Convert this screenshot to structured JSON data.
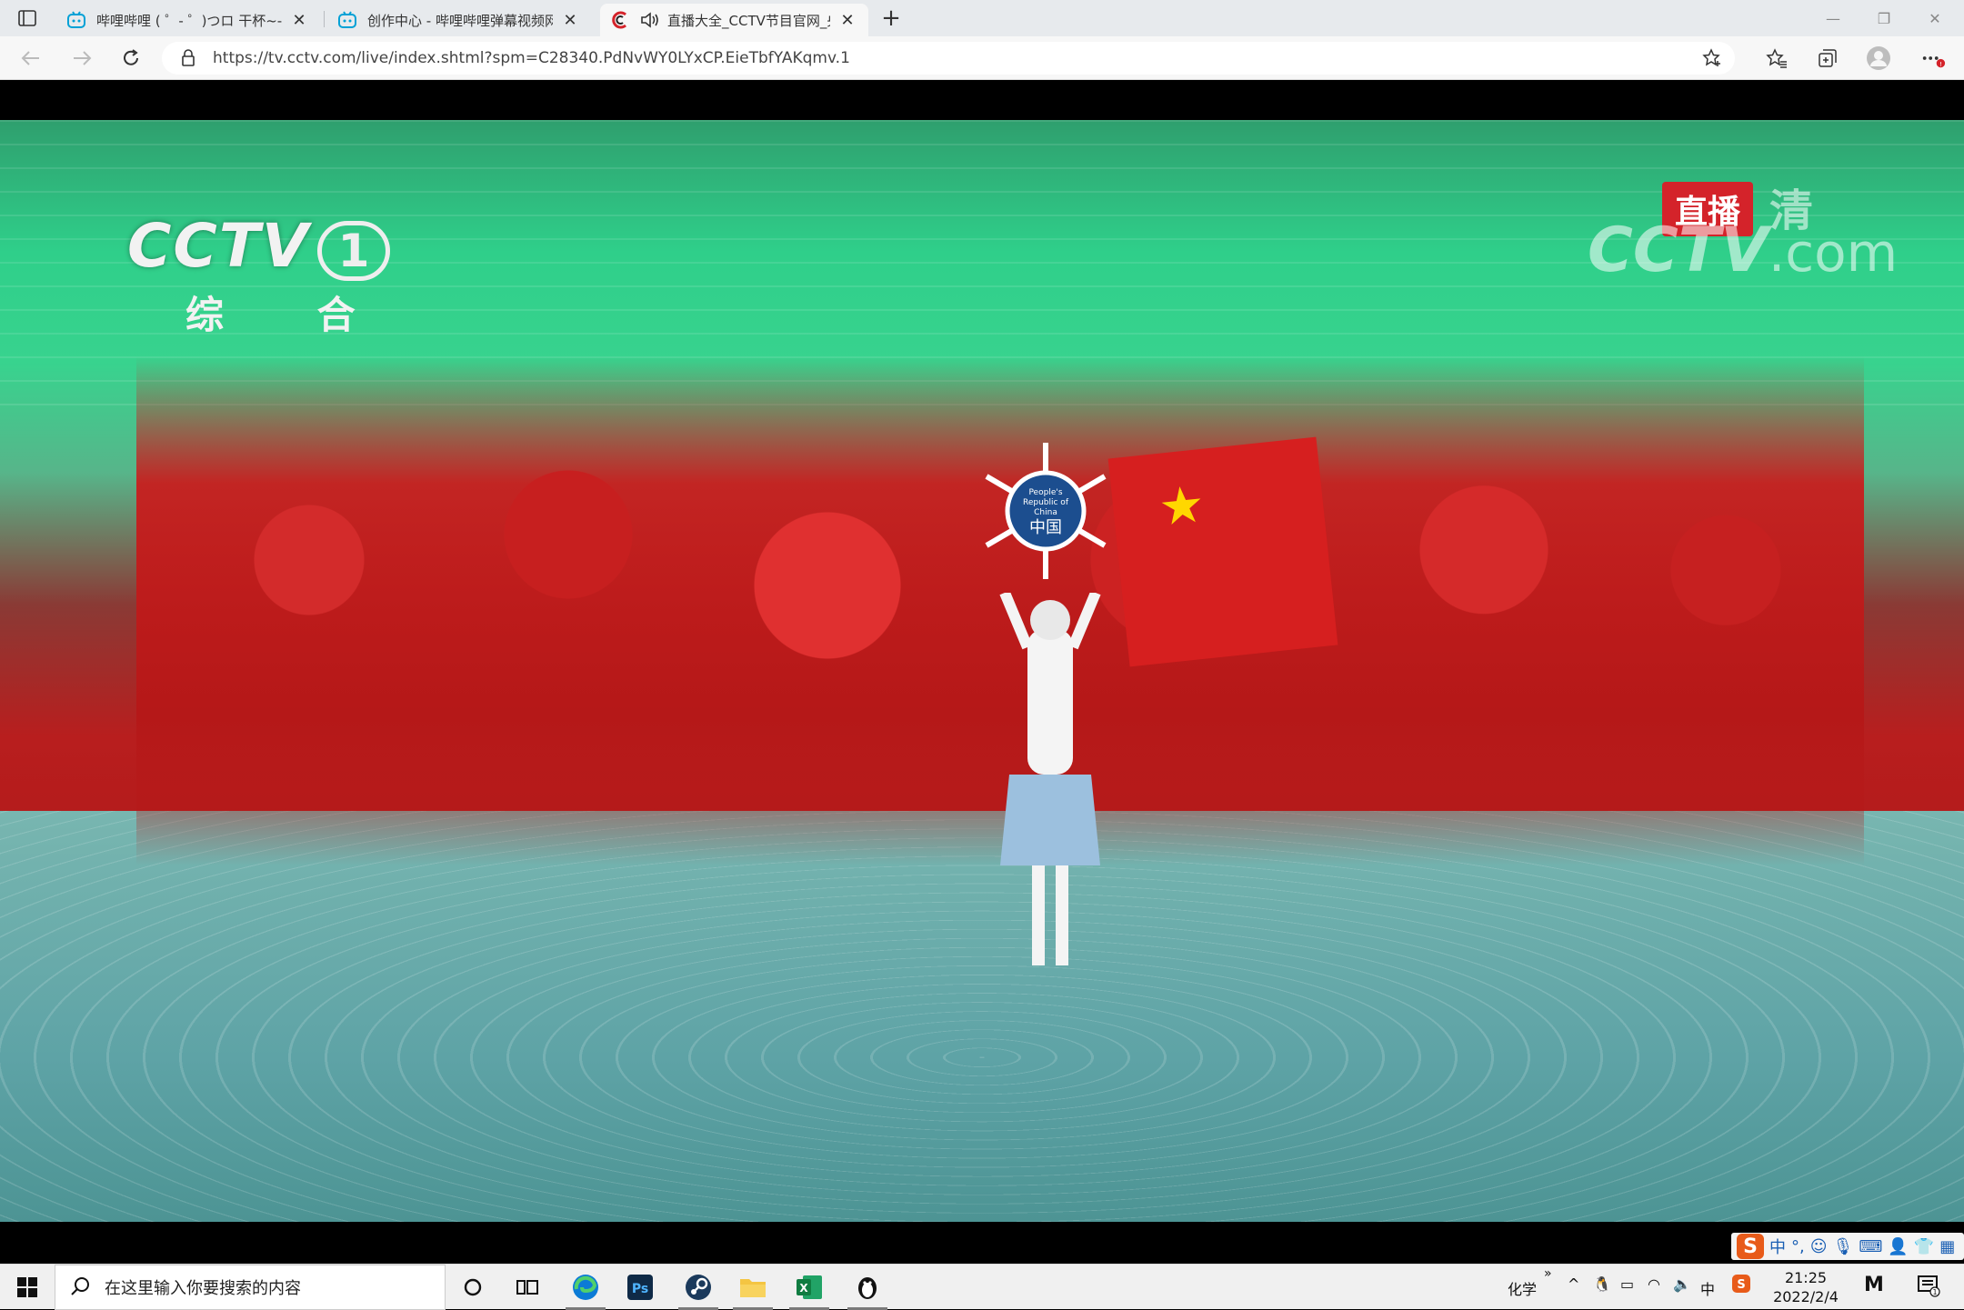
{
  "browser": {
    "tabs": [
      {
        "title": "哔哩哔哩 ( ゜- ゜)つロ 干杯~-bilibili",
        "favicon": "bilibili-icon",
        "active": false
      },
      {
        "title": "创作中心 - 哔哩哔哩弹幕视频网",
        "favicon": "bilibili-icon",
        "active": false
      },
      {
        "title": "直播大全_CCTV节目官网_央视网",
        "favicon": "cctv-icon",
        "active": true,
        "audio": "speaker-icon"
      }
    ],
    "new_tab_label": "+",
    "address": "https://tv.cctv.com/live/index.shtml?spm=C28340.PdNvWY0LYxCP.EieTbfYAKqmv.1",
    "notification_badge": "!"
  },
  "video": {
    "channel_logo_text": "CCTV",
    "channel_number": "1",
    "channel_name": "综 合",
    "live_badge": "直播",
    "watermark_main": "CCTV",
    "watermark_ext": ".com",
    "watermark_char": "清",
    "sign_text_line1": "People's",
    "sign_text_line2": "Republic of",
    "sign_text_line3": "China",
    "sign_text_cn": "中国"
  },
  "ime": {
    "mode": "中",
    "punct": "°,"
  },
  "taskbar": {
    "search_placeholder": "在这里输入你要搜索的内容",
    "tray_label": "化学",
    "tray_more": "»",
    "lang": "中",
    "time": "21:25",
    "date": "2022/2/4",
    "notif_count": "1"
  },
  "colors": {
    "accent_red": "#d4232a",
    "bilibili_blue": "#00a1d6",
    "edge_blue": "#0078d4"
  }
}
